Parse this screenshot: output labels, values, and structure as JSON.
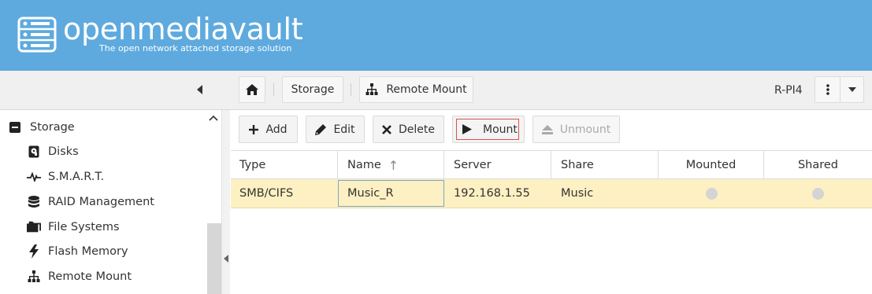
{
  "header": {
    "title": "openmediavault",
    "subtitle": "The open network attached storage solution"
  },
  "toolbar": {
    "home_icon": "home-icon",
    "crumb_storage": "Storage",
    "crumb_remote_mount": "Remote Mount",
    "hostname": "R-PI4"
  },
  "sidebar": {
    "items": [
      {
        "label": "Storage",
        "icon": "minus-square-icon"
      },
      {
        "label": "Disks",
        "icon": "disk-icon"
      },
      {
        "label": "S.M.A.R.T.",
        "icon": "heartbeat-icon"
      },
      {
        "label": "RAID Management",
        "icon": "database-icon"
      },
      {
        "label": "File Systems",
        "icon": "folders-icon"
      },
      {
        "label": "Flash Memory",
        "icon": "flash-icon"
      },
      {
        "label": "Remote Mount",
        "icon": "sitemap-icon"
      }
    ]
  },
  "actions": {
    "add": "Add",
    "edit": "Edit",
    "delete": "Delete",
    "mount": "Mount",
    "unmount": "Unmount"
  },
  "table": {
    "columns": [
      "Type",
      "Name",
      "Server",
      "Share",
      "Mounted",
      "Shared"
    ],
    "sort_indicator": "↑",
    "rows": [
      {
        "type": "SMB/CIFS",
        "name": "Music_R",
        "server": "192.168.1.55",
        "share": "Music",
        "mounted": false,
        "shared": false
      }
    ]
  },
  "colors": {
    "header_bg": "#5eaade",
    "selected_row": "#fdf0c2",
    "mount_outline": "#d9534f"
  }
}
